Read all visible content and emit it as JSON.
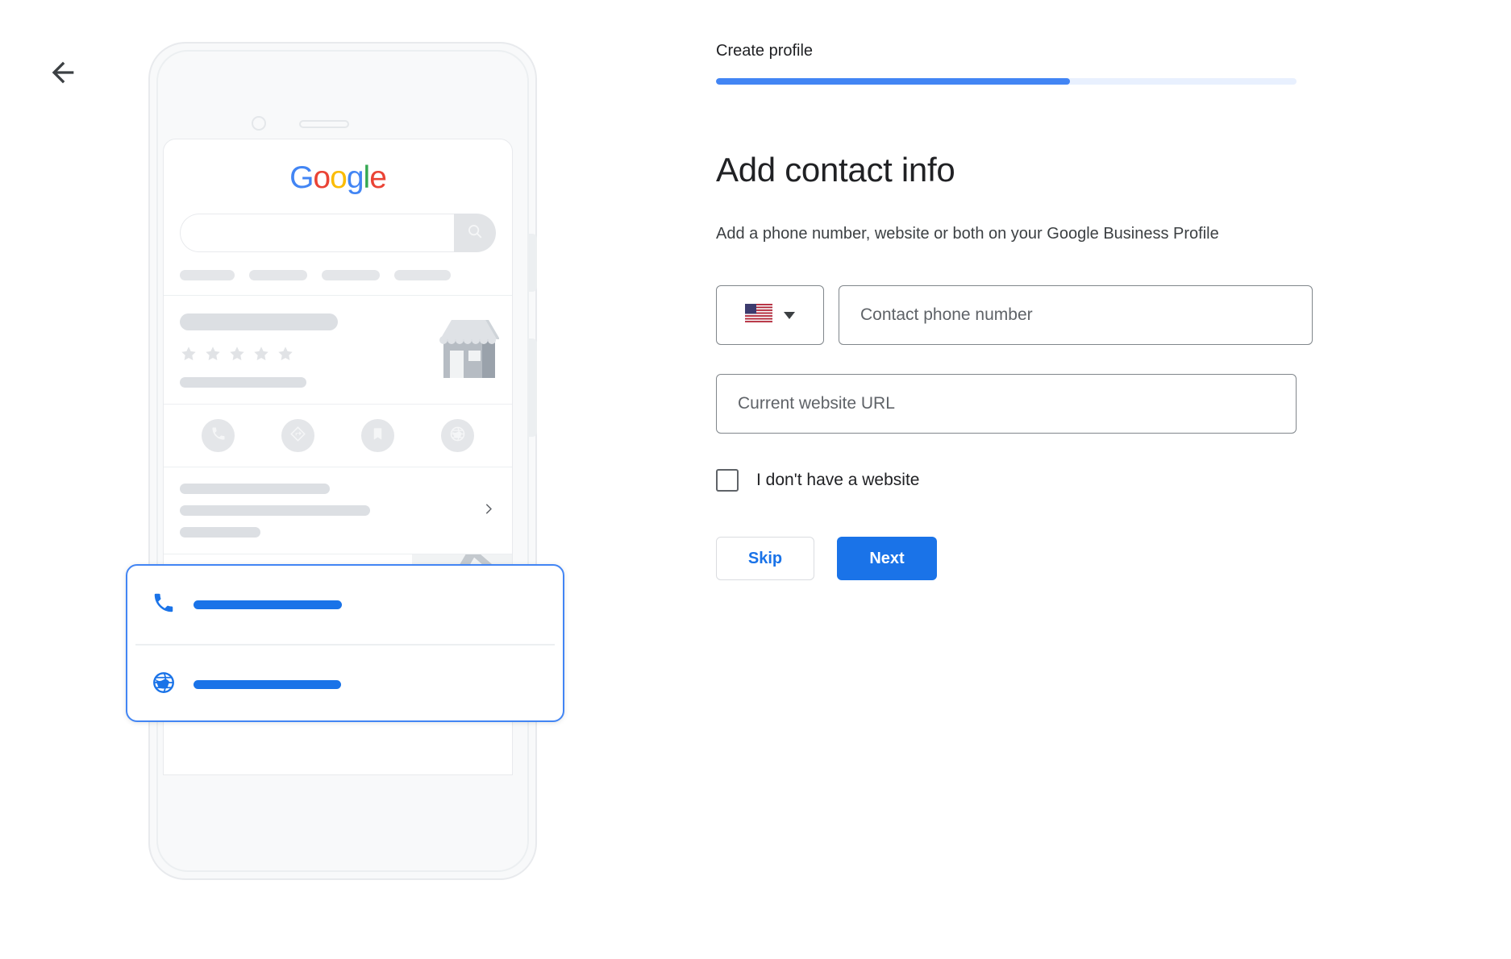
{
  "nav": {
    "back_icon": "arrow-back-icon"
  },
  "progress": {
    "label": "Create profile",
    "percent": 61,
    "fill_color": "#4285F4",
    "track_color": "#e8f0fe"
  },
  "main": {
    "headline": "Add contact info",
    "subhead": "Add a phone number, website or both on your Google Business Profile",
    "phone": {
      "country_flag": "🇺🇸",
      "country_code_icon": "us-flag-icon",
      "dropdown_icon": "caret-down-icon",
      "placeholder": "Contact phone number",
      "value": ""
    },
    "website": {
      "placeholder": "Current website URL",
      "value": ""
    },
    "no_website_checkbox": {
      "label": "I don't have a website",
      "checked": false
    },
    "buttons": {
      "skip": "Skip",
      "next": "Next"
    }
  },
  "illustration": {
    "phone_frame": {
      "camera_icon": "camera-dot-icon",
      "speaker_icon": "speaker-slot-icon"
    },
    "google_logo": {
      "letters": [
        "G",
        "o",
        "o",
        "g",
        "l",
        "e"
      ],
      "colors": [
        "#4285F4",
        "#EA4335",
        "#FBBC05",
        "#4285F4",
        "#34A853",
        "#EA4335"
      ]
    },
    "search": {
      "search_icon": "search-icon"
    },
    "business_card": {
      "rating_stars": 5,
      "star_icon": "star-icon",
      "storefront_icon": "storefront-icon"
    },
    "action_icons": [
      {
        "name": "call-icon"
      },
      {
        "name": "directions-icon"
      },
      {
        "name": "save-bookmark-icon"
      },
      {
        "name": "website-globe-icon"
      }
    ],
    "list_row": {
      "chevron_icon": "chevron-right-icon"
    },
    "address_row": {
      "pin_icon": "map-pin-icon",
      "map_thumbnail_icon": "map-thumbnail"
    },
    "hours_row": {
      "clock_icon": "clock-icon"
    },
    "highlight_card": {
      "rows": [
        {
          "icon": "phone-icon",
          "color": "#1a73e8"
        },
        {
          "icon": "globe-icon",
          "color": "#1a73e8"
        }
      ],
      "border_color": "#4285F4"
    }
  }
}
